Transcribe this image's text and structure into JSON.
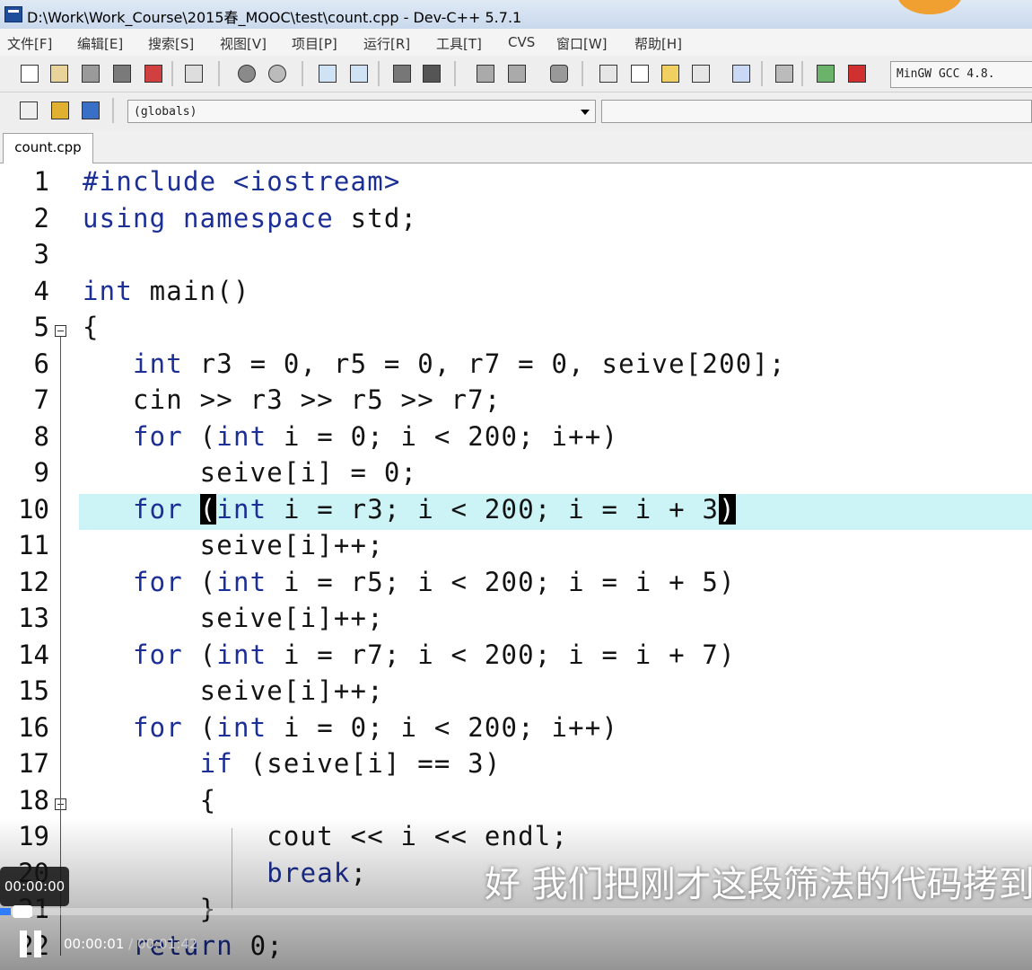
{
  "window": {
    "title": "D:\\Work\\Work_Course\\2015春_MOOC\\test\\count.cpp - Dev-C++ 5.7.1"
  },
  "menu": [
    "文件[F]",
    "编辑[E]",
    "搜索[S]",
    "视图[V]",
    "项目[P]",
    "运行[R]",
    "工具[T]",
    "CVS",
    "窗口[W]",
    "帮助[H]"
  ],
  "toolbar": {
    "compiler": "MinGW GCC 4.8.",
    "scope": "(globals)"
  },
  "tab": {
    "label": "count.cpp"
  },
  "editor": {
    "active_line": 10,
    "lines": [
      {
        "n": "1",
        "segs": [
          {
            "t": "#include <iostream>",
            "c": "pre"
          }
        ]
      },
      {
        "n": "2",
        "segs": [
          {
            "t": "using namespace",
            "c": "kw"
          },
          {
            "t": " std;",
            "c": ""
          }
        ]
      },
      {
        "n": "3",
        "segs": []
      },
      {
        "n": "4",
        "segs": [
          {
            "t": "int",
            "c": "kw"
          },
          {
            "t": " main()",
            "c": ""
          }
        ]
      },
      {
        "n": "5",
        "segs": [
          {
            "t": "{",
            "c": ""
          }
        ]
      },
      {
        "n": "6",
        "segs": [
          {
            "t": "   ",
            "c": ""
          },
          {
            "t": "int",
            "c": "kw"
          },
          {
            "t": " r3 = 0, r5 = 0, r7 = 0, seive[200];",
            "c": ""
          }
        ]
      },
      {
        "n": "7",
        "segs": [
          {
            "t": "   cin >> r3 >> r5 >> r7;",
            "c": ""
          }
        ]
      },
      {
        "n": "8",
        "segs": [
          {
            "t": "   ",
            "c": ""
          },
          {
            "t": "for",
            "c": "kw"
          },
          {
            "t": " (",
            "c": ""
          },
          {
            "t": "int",
            "c": "kw"
          },
          {
            "t": " i = 0; i < 200; i++)",
            "c": ""
          }
        ]
      },
      {
        "n": "9",
        "segs": [
          {
            "t": "       seive[i] = 0;",
            "c": ""
          }
        ]
      },
      {
        "n": "10",
        "segs": [
          {
            "t": "   ",
            "c": ""
          },
          {
            "t": "for",
            "c": "kw"
          },
          {
            "t": " ",
            "c": ""
          },
          {
            "t": "(",
            "c": "hl"
          },
          {
            "t": "int",
            "c": "kw"
          },
          {
            "t": " i = r3; i < 200; i = i + 3",
            "c": ""
          },
          {
            "t": ")",
            "c": "hl"
          }
        ]
      },
      {
        "n": "11",
        "segs": [
          {
            "t": "       seive[i]++;",
            "c": ""
          }
        ]
      },
      {
        "n": "12",
        "segs": [
          {
            "t": "   ",
            "c": ""
          },
          {
            "t": "for",
            "c": "kw"
          },
          {
            "t": " (",
            "c": ""
          },
          {
            "t": "int",
            "c": "kw"
          },
          {
            "t": " i = r5; i < 200; i = i + 5)",
            "c": ""
          }
        ]
      },
      {
        "n": "13",
        "segs": [
          {
            "t": "       seive[i]++;",
            "c": ""
          }
        ]
      },
      {
        "n": "14",
        "segs": [
          {
            "t": "   ",
            "c": ""
          },
          {
            "t": "for",
            "c": "kw"
          },
          {
            "t": " (",
            "c": ""
          },
          {
            "t": "int",
            "c": "kw"
          },
          {
            "t": " i = r7; i < 200; i = i + 7)",
            "c": ""
          }
        ]
      },
      {
        "n": "15",
        "segs": [
          {
            "t": "       seive[i]++;",
            "c": ""
          }
        ]
      },
      {
        "n": "16",
        "segs": [
          {
            "t": "   ",
            "c": ""
          },
          {
            "t": "for",
            "c": "kw"
          },
          {
            "t": " (",
            "c": ""
          },
          {
            "t": "int",
            "c": "kw"
          },
          {
            "t": " i = 0; i < 200; i++)",
            "c": ""
          }
        ]
      },
      {
        "n": "17",
        "segs": [
          {
            "t": "       ",
            "c": ""
          },
          {
            "t": "if",
            "c": "kw"
          },
          {
            "t": " (seive[i] == 3)",
            "c": ""
          }
        ]
      },
      {
        "n": "18",
        "segs": [
          {
            "t": "       {",
            "c": ""
          }
        ]
      },
      {
        "n": "19",
        "segs": [
          {
            "t": "           cout << i << endl;",
            "c": ""
          }
        ]
      },
      {
        "n": "20",
        "segs": [
          {
            "t": "           ",
            "c": ""
          },
          {
            "t": "break",
            "c": "kw"
          },
          {
            "t": ";",
            "c": ""
          }
        ]
      },
      {
        "n": "21",
        "segs": [
          {
            "t": "       }",
            "c": ""
          }
        ]
      },
      {
        "n": "22",
        "segs": [
          {
            "t": "   ",
            "c": ""
          },
          {
            "t": "return",
            "c": "kw"
          },
          {
            "t": " 0;",
            "c": ""
          }
        ]
      }
    ]
  },
  "video": {
    "subtitle": "好 我们把刚才这段筛法的代码拷到",
    "hover_time": "00:00:00",
    "current_time": "00:00:01",
    "separator": " / ",
    "total_time": "00:01:42",
    "progress_fraction": 0.01
  }
}
